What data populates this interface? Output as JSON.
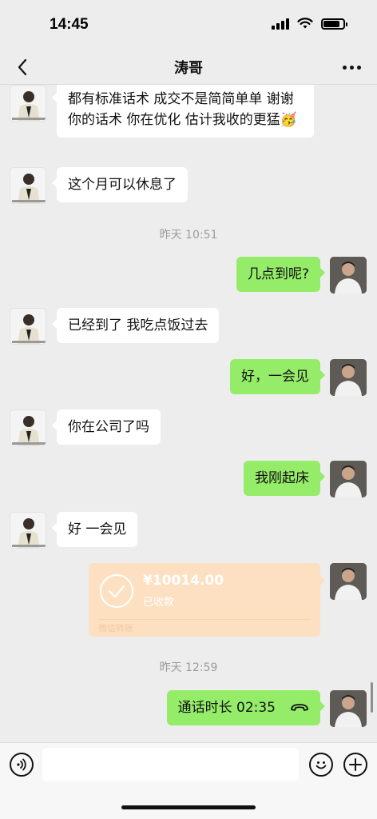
{
  "status": {
    "time": "14:45"
  },
  "nav": {
    "title": "涛哥"
  },
  "messages": [
    {
      "side": "left",
      "text": "都有标准话术 成交不是简简单单 谢谢你的话术 你在优化 估计我收的更猛🥳"
    },
    {
      "side": "left",
      "text": "这个月可以休息了"
    },
    {
      "timestamp": "昨天 10:51"
    },
    {
      "side": "right",
      "text": "几点到呢?"
    },
    {
      "side": "left",
      "text": "已经到了 我吃点饭过去"
    },
    {
      "side": "right",
      "text": "好，一会见"
    },
    {
      "side": "left",
      "text": "你在公司了吗"
    },
    {
      "side": "right",
      "text": "我刚起床"
    },
    {
      "side": "left",
      "text": "好 一会见"
    },
    {
      "side": "right",
      "transfer": {
        "amount": "¥10014.00",
        "status": "已收款",
        "footer": "微信转账"
      }
    },
    {
      "timestamp": "昨天 12:59"
    },
    {
      "side": "right",
      "call": "通话时长 02:35"
    }
  ],
  "icons": {
    "back": "chevron-left-icon",
    "more": "more-dots-icon",
    "voice": "voice-icon",
    "emoji": "emoji-icon",
    "plus": "plus-icon",
    "phone": "phone-hangup-icon",
    "check": "check-icon"
  },
  "colors": {
    "background": "#ededed",
    "bubble_self": "#95ec69",
    "bubble_other": "#ffffff",
    "transfer": "#fde0c1",
    "timestamp": "#9b9b9b"
  }
}
